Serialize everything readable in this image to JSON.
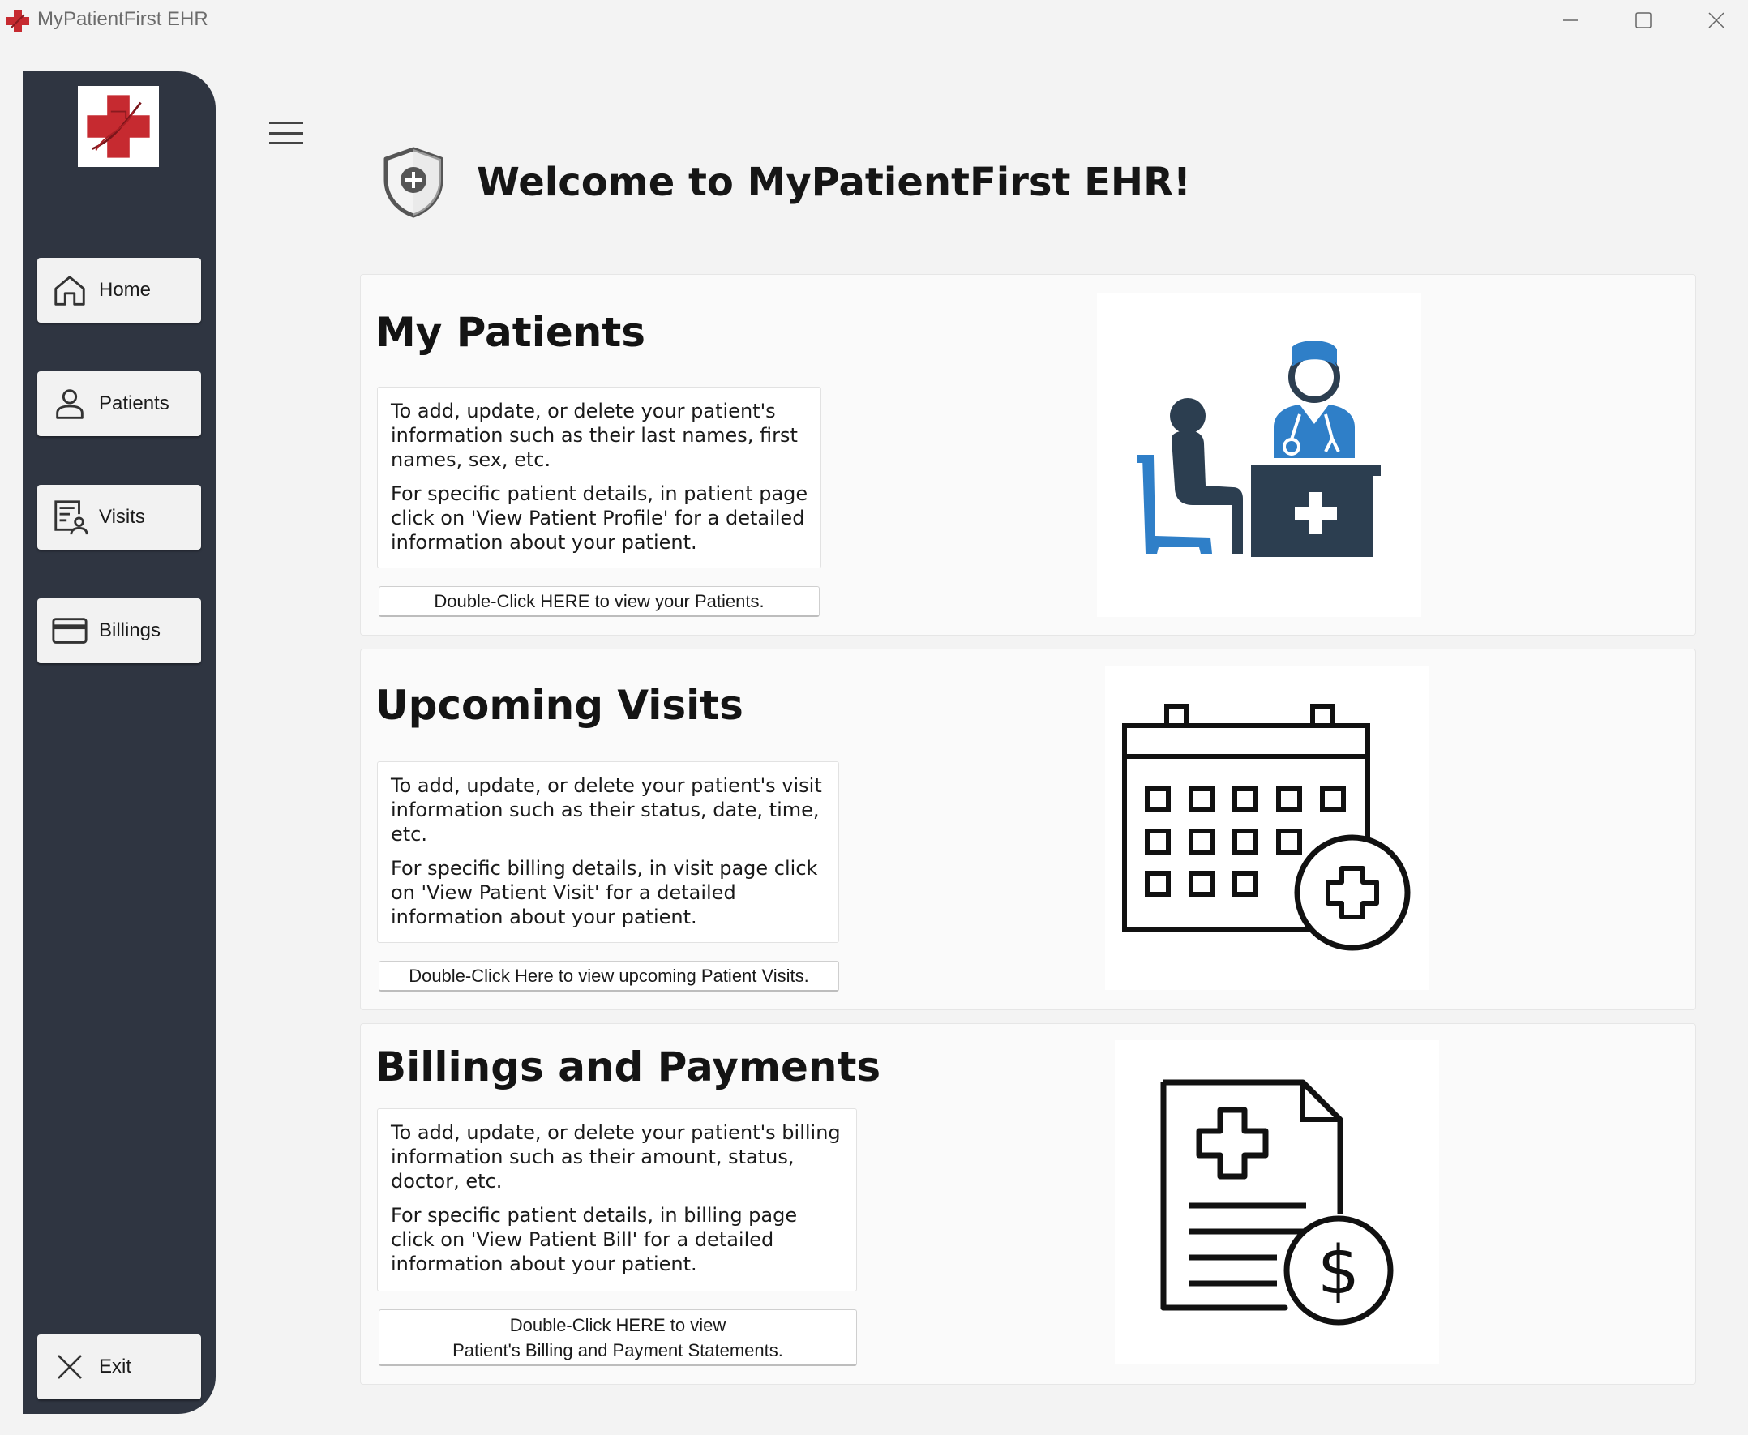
{
  "window": {
    "title": "MyPatientFirst EHR",
    "controls": [
      "minimize",
      "maximize",
      "close"
    ]
  },
  "sidebar": {
    "logo": "red-cross-logo",
    "items": [
      {
        "label": "Home",
        "icon": "home-icon"
      },
      {
        "label": "Patients",
        "icon": "person-icon"
      },
      {
        "label": "Visits",
        "icon": "visits-icon"
      },
      {
        "label": "Billings",
        "icon": "credit-card-icon"
      }
    ],
    "exit": {
      "label": "Exit",
      "icon": "close-icon"
    }
  },
  "header": {
    "title": "Welcome to MyPatientFirst EHR!",
    "icon": "shield-plus-icon"
  },
  "cards": [
    {
      "title": "My Patients",
      "desc1": "To add, update, or delete your patient's information such as their last names, first names, sex, etc.",
      "desc2": "For specific patient details, in patient page click on 'View Patient Profile' for a detailed information about your patient.",
      "button": "Double-Click HERE to view your Patients.",
      "image": "doctor-patient-illustration"
    },
    {
      "title": "Upcoming Visits",
      "desc1": "To add, update, or delete your patient's visit information such as their status, date, time, etc.",
      "desc2": "For specific billing details, in visit page click on 'View Patient Visit' for a detailed information about your patient.",
      "button": "Double-Click Here to view upcoming Patient Visits.",
      "image": "calendar-plus-illustration"
    },
    {
      "title": "Billings and Payments",
      "desc1": "To add, update, or delete your patient's billing information such as their amount, status, doctor, etc.",
      "desc2": "For specific patient details, in billing page click on 'View Patient Bill' for a detailed information about your patient.",
      "button": "Double-Click HERE to view\nPatient's Billing and Payment Statements.",
      "image": "medical-bill-illustration"
    }
  ],
  "colors": {
    "sidebar": "#2f3541",
    "brand_red": "#c62a30",
    "illustration_blue": "#2f7fc8",
    "illustration_dark": "#2c3e50"
  }
}
